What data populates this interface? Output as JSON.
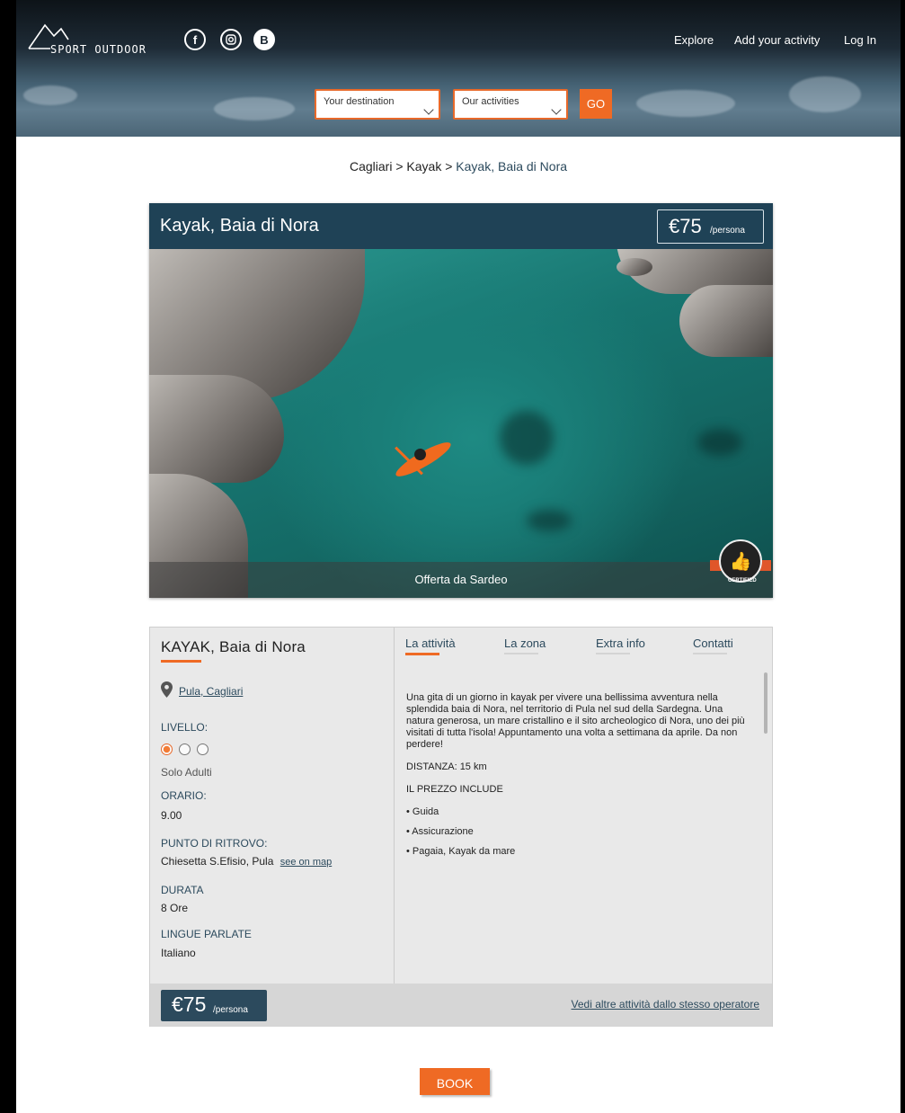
{
  "header": {
    "logo_text": "SPORT OUTDOOR",
    "social_icons": [
      "facebook-icon",
      "instagram-icon",
      "blogger-icon"
    ],
    "nav": {
      "explore": "Explore",
      "add_activity": "Add your activity",
      "login": "Log In"
    },
    "search": {
      "destination": "Your destination",
      "activities": "Our activities",
      "go": "GO"
    }
  },
  "breadcrumb": {
    "level1": "Cagliari",
    "sep1": ">",
    "level2": "Kayak",
    "sep2": ">",
    "current": "Kayak, Baia di Nora"
  },
  "card": {
    "title": "Kayak, Baia di Nora",
    "price": "€75",
    "price_unit": "/persona",
    "caption": "Offerta da Sardeo",
    "badge": "CERTIFIED"
  },
  "details": {
    "title": "KAYAK, Baia di Nora",
    "location": "Pula, Cagliari",
    "level_label": "LIVELLO:",
    "level_value": 1,
    "level_max": 3,
    "audience": "Solo Adulti",
    "time_label": "ORARIO:",
    "time_value": "9.00",
    "meeting_label": "PUNTO DI RITROVO:",
    "meeting_value": "Chiesetta S.Efisio, Pula",
    "meeting_map": "see on map",
    "duration_label": "DURATA",
    "duration_value": "8 Ore",
    "languages_label": "LINGUE PARLATE",
    "languages_value": "Italiano"
  },
  "tabs": [
    "La attività",
    "La zona",
    "Extra info",
    "Contatti"
  ],
  "content": {
    "description": "Una gita di un giorno in kayak per vivere una bellissima avventura nella splendida baia di Nora, nel territorio di Pula nel sud della Sardegna. Una natura generosa, un mare cristallino e il sito archeologico di Nora, uno dei più visitati di tutta l'isola! Appuntamento una volta a settimana da aprile. Da non perdere!",
    "distance": "DISTANZA: 15 km",
    "includes_title": "IL PREZZO INCLUDE",
    "includes": [
      "• Guida",
      "• Assicurazione",
      "• Pagaia, Kayak da mare"
    ]
  },
  "footer": {
    "price": "€75",
    "price_unit": "/persona",
    "more_link": "Vedi altre attività  dallo stesso operatore"
  },
  "book_label": "BOOK",
  "colors": {
    "accent": "#ef6a24",
    "navy": "#1f4256",
    "link": "#2c4a5d"
  }
}
